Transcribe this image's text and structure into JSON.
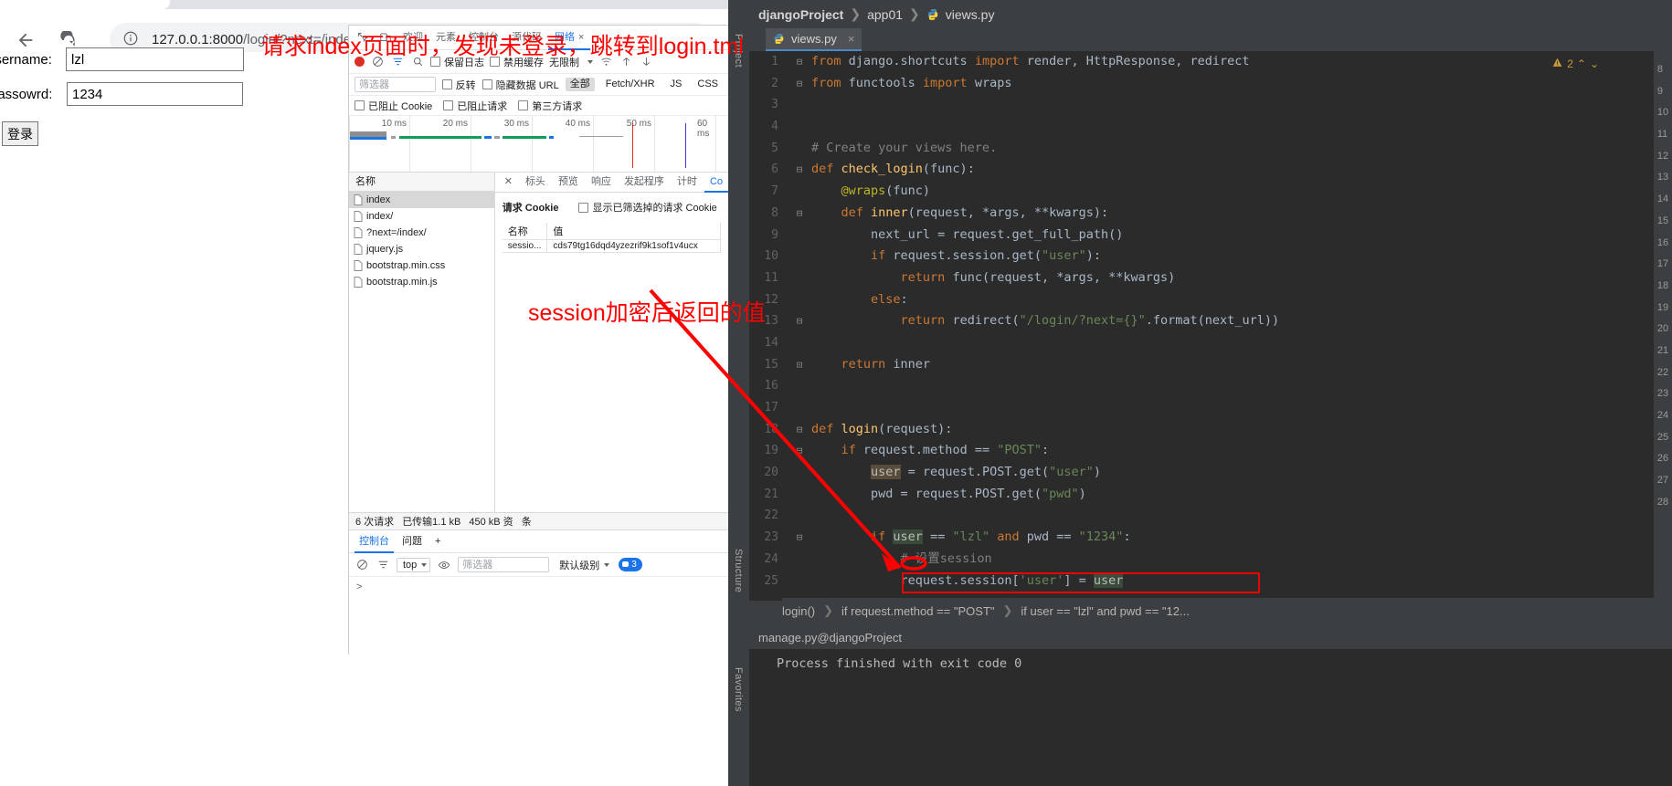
{
  "browser": {
    "back_icon": "back-arrow-icon",
    "reload_icon": "reload-icon",
    "info_icon": "info-circle-icon",
    "url_main": "127.0.0.1:8000",
    "url_path": "/login/?next=/index/",
    "cast_icon": "cast-icon",
    "apps_icon": "apps-grid-icon"
  },
  "page": {
    "username_label": "username:",
    "username_value": "lzl",
    "password_label": "passowrd:",
    "password_value": "1234",
    "submit_label": "登录"
  },
  "annotations": {
    "note1": "请求index页面时，发现未登录，跳转到login.tml",
    "note2": "session加密后返回的值"
  },
  "devtools": {
    "tabs": [
      {
        "label": "欢迎",
        "selected": false
      },
      {
        "label": "元素",
        "selected": false
      },
      {
        "label": "控制台",
        "selected": false
      },
      {
        "label": "源代码",
        "selected": false
      },
      {
        "label": "网络",
        "selected": true,
        "closable": true
      }
    ],
    "inspect_icon": "inspect-icon",
    "device_icon": "device-toggle-icon",
    "more_icon": "more-vertical-icon",
    "toolbar": {
      "record_icon": "record-stop-icon",
      "clear_icon": "clear-circle-icon",
      "filter_icon": "filter-icon",
      "search_icon": "search-icon",
      "preserve_log": "保留日志",
      "disable_cache": "禁用缓存",
      "throttle": "无限制",
      "wifi_icon": "wifi-throttle-icon",
      "import_icon": "upload-arrow-icon",
      "export_icon": "download-arrow-icon"
    },
    "filterbar": {
      "placeholder": "筛选器",
      "invert": "反转",
      "hide_data_urls": "隐藏数据 URL",
      "chips": [
        "全部",
        "Fetch/XHR",
        "JS",
        "CSS"
      ],
      "selected_chip": "全部"
    },
    "filterbar2": {
      "blocked_cookies": "已阻止 Cookie",
      "blocked_requests": "已阻止请求",
      "third_party": "第三方请求"
    },
    "overview_ticks": [
      "10 ms",
      "20 ms",
      "30 ms",
      "40 ms",
      "50 ms",
      "60 ms"
    ],
    "requests_header": "名称",
    "requests": [
      {
        "name": "index",
        "selected": true
      },
      {
        "name": "index/",
        "selected": false
      },
      {
        "name": "?next=/index/",
        "selected": false
      },
      {
        "name": "jquery.js",
        "selected": false
      },
      {
        "name": "bootstrap.min.css",
        "selected": false
      },
      {
        "name": "bootstrap.min.js",
        "selected": false
      }
    ],
    "detail_tabs": [
      {
        "label": "标头",
        "selected": false
      },
      {
        "label": "预览",
        "selected": false
      },
      {
        "label": "响应",
        "selected": false
      },
      {
        "label": "发起程序",
        "selected": false
      },
      {
        "label": "计时",
        "selected": false
      },
      {
        "label": "Co",
        "selected": true
      }
    ],
    "close_icon": "close-x-icon",
    "cookie_panel": {
      "title": "请求 Cookie",
      "show_filtered": "显示已筛选掉的请求 Cookie",
      "columns": [
        "名称",
        "值"
      ],
      "rows": [
        {
          "name": "sessio...",
          "value": "cds79tg16dqd4yzezrif9k1sof1v4ucx"
        }
      ]
    },
    "status": {
      "requests": "6 次请求",
      "transferred": "已传输1.1 kB",
      "resources": "450 kB 资",
      "tail": "条"
    },
    "console": {
      "tabs": [
        {
          "label": "控制台",
          "selected": true
        },
        {
          "label": "问题",
          "selected": false
        }
      ],
      "add_icon": "plus-icon",
      "more_icon": "more-vertical-icon",
      "clear_icon": "clear-circle-icon",
      "context": "top",
      "eye_icon": "eye-icon",
      "filter_placeholder": "筛选器",
      "level": "默认级别",
      "message_count": "3",
      "prompt": ">"
    }
  },
  "ide": {
    "breadcrumb": {
      "project": "djangoProject",
      "app": "app01",
      "file": "views.py"
    },
    "tab": {
      "label": "views.py",
      "close": "×"
    },
    "rails": {
      "project": "Project",
      "structure": "Structure",
      "favorites": "Favorites"
    },
    "warnings": {
      "count": "2",
      "icon": "warning-triangle-icon"
    },
    "code": [
      {
        "n": "1",
        "fold": "⊟",
        "tokens": [
          {
            "t": "from ",
            "c": "kw"
          },
          {
            "t": "django.shortcuts ",
            "c": "plain"
          },
          {
            "t": "import ",
            "c": "kw"
          },
          {
            "t": "render, HttpResponse, redirect",
            "c": "plain"
          }
        ]
      },
      {
        "n": "2",
        "fold": "⊟",
        "tokens": [
          {
            "t": "from ",
            "c": "kw"
          },
          {
            "t": "functools ",
            "c": "plain"
          },
          {
            "t": "import ",
            "c": "kw"
          },
          {
            "t": "wraps",
            "c": "plain"
          }
        ]
      },
      {
        "n": "3",
        "fold": "",
        "tokens": []
      },
      {
        "n": "4",
        "fold": "",
        "tokens": []
      },
      {
        "n": "5",
        "fold": "",
        "tokens": [
          {
            "t": "# Create your views here.",
            "c": "cmt"
          }
        ]
      },
      {
        "n": "6",
        "fold": "⊟",
        "tokens": [
          {
            "t": "def ",
            "c": "kw"
          },
          {
            "t": "check_login",
            "c": "fn"
          },
          {
            "t": "(func):",
            "c": "plain"
          }
        ]
      },
      {
        "n": "7",
        "fold": "",
        "tokens": [
          {
            "t": "    @wraps",
            "c": "dec"
          },
          {
            "t": "(func)",
            "c": "plain"
          }
        ]
      },
      {
        "n": "8",
        "fold": "⊟",
        "tokens": [
          {
            "t": "    ",
            "c": "plain"
          },
          {
            "t": "def ",
            "c": "kw"
          },
          {
            "t": "inner",
            "c": "fn"
          },
          {
            "t": "(request, *args, **kwargs):",
            "c": "plain"
          }
        ]
      },
      {
        "n": "9",
        "fold": "",
        "tokens": [
          {
            "t": "        next_url = request.get_full_path()",
            "c": "plain"
          }
        ]
      },
      {
        "n": "10",
        "fold": "",
        "tokens": [
          {
            "t": "        ",
            "c": "plain"
          },
          {
            "t": "if ",
            "c": "kw"
          },
          {
            "t": "request.session.get(",
            "c": "plain"
          },
          {
            "t": "\"user\"",
            "c": "str"
          },
          {
            "t": "):",
            "c": "plain"
          }
        ]
      },
      {
        "n": "11",
        "fold": "",
        "tokens": [
          {
            "t": "            ",
            "c": "plain"
          },
          {
            "t": "return ",
            "c": "kw"
          },
          {
            "t": "func(request, *args, **kwargs)",
            "c": "plain"
          }
        ]
      },
      {
        "n": "12",
        "fold": "",
        "tokens": [
          {
            "t": "        ",
            "c": "plain"
          },
          {
            "t": "else",
            "c": "kw"
          },
          {
            "t": ":",
            "c": "plain"
          }
        ]
      },
      {
        "n": "13",
        "fold": "⊟",
        "tokens": [
          {
            "t": "            ",
            "c": "plain"
          },
          {
            "t": "return ",
            "c": "kw"
          },
          {
            "t": "redirect(",
            "c": "plain"
          },
          {
            "t": "\"/login/?next={}\"",
            "c": "str"
          },
          {
            "t": ".format(next_url))",
            "c": "plain"
          }
        ]
      },
      {
        "n": "14",
        "fold": "",
        "tokens": []
      },
      {
        "n": "15",
        "fold": "⊡",
        "tokens": [
          {
            "t": "    ",
            "c": "plain"
          },
          {
            "t": "return ",
            "c": "kw"
          },
          {
            "t": "inner",
            "c": "plain"
          }
        ]
      },
      {
        "n": "16",
        "fold": "",
        "tokens": []
      },
      {
        "n": "17",
        "fold": "",
        "tokens": []
      },
      {
        "n": "18",
        "fold": "⊟",
        "tokens": [
          {
            "t": "def ",
            "c": "kw"
          },
          {
            "t": "login",
            "c": "fn"
          },
          {
            "t": "(request):",
            "c": "plain"
          }
        ]
      },
      {
        "n": "19",
        "fold": "⊟",
        "tokens": [
          {
            "t": "    ",
            "c": "plain"
          },
          {
            "t": "if ",
            "c": "kw"
          },
          {
            "t": "request.method == ",
            "c": "plain"
          },
          {
            "t": "\"POST\"",
            "c": "str"
          },
          {
            "t": ":",
            "c": "plain"
          }
        ]
      },
      {
        "n": "20",
        "fold": "",
        "tokens": [
          {
            "t": "        ",
            "c": "plain"
          },
          {
            "t": "user",
            "c": "hl"
          },
          {
            "t": " = request.POST.get(",
            "c": "plain"
          },
          {
            "t": "\"user\"",
            "c": "str"
          },
          {
            "t": ")",
            "c": "plain"
          }
        ]
      },
      {
        "n": "21",
        "fold": "",
        "tokens": [
          {
            "t": "        pwd = request.POST.get(",
            "c": "plain"
          },
          {
            "t": "\"pwd\"",
            "c": "str"
          },
          {
            "t": ")",
            "c": "plain"
          }
        ]
      },
      {
        "n": "22",
        "fold": "",
        "tokens": []
      },
      {
        "n": "23",
        "fold": "⊟",
        "tokens": [
          {
            "t": "        ",
            "c": "plain"
          },
          {
            "t": "if ",
            "c": "kw"
          },
          {
            "t": "user",
            "c": "hl2"
          },
          {
            "t": " == ",
            "c": "plain"
          },
          {
            "t": "\"lzl\"",
            "c": "str"
          },
          {
            "t": " ",
            "c": "plain"
          },
          {
            "t": "and",
            "c": "kw"
          },
          {
            "t": " pwd == ",
            "c": "plain"
          },
          {
            "t": "\"1234\"",
            "c": "str"
          },
          {
            "t": ":",
            "c": "plain"
          }
        ]
      },
      {
        "n": "24",
        "fold": "",
        "tokens": [
          {
            "t": "            # 设置session",
            "c": "cmt"
          }
        ]
      },
      {
        "n": "25",
        "fold": "",
        "tokens": [
          {
            "t": "            request.session[",
            "c": "plain"
          },
          {
            "t": "'user'",
            "c": "str"
          },
          {
            "t": "] = ",
            "c": "plain"
          },
          {
            "t": "user",
            "c": "hl2"
          }
        ]
      }
    ],
    "right_gutter_numbers": [
      "8",
      "9",
      "10",
      "11",
      "12",
      "13",
      "14",
      "15",
      "16",
      "17",
      "18",
      "19",
      "20",
      "21",
      "22",
      "23",
      "24",
      "25",
      "26",
      "27",
      "28"
    ],
    "bottom_breadcrumb": [
      "login()",
      "if request.method == \"POST\"",
      "if user == \"lzl\" and pwd == \"12..."
    ],
    "run_config": "manage.py@djangoProject",
    "console_output": "Process finished with exit code 0",
    "bulb_icon": "lightbulb-icon"
  }
}
